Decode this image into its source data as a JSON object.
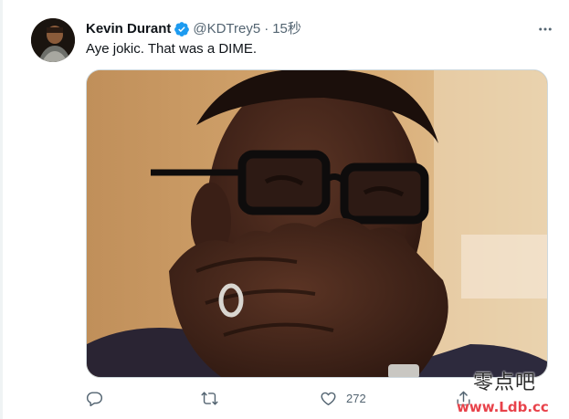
{
  "tweet": {
    "author_name": "Kevin Durant",
    "handle": "@KDTrey5",
    "separator": "·",
    "timestamp": "15秒",
    "text": "Aye jokic. That was a DIME."
  },
  "actions": {
    "replies": "",
    "retweets": "",
    "likes": "272"
  },
  "colors": {
    "verified_badge": "#1d9bf0",
    "secondary_text": "#536471",
    "primary_text": "#0f1419",
    "watermark_url": "#e8424a"
  },
  "watermark": {
    "chinese": "零点吧",
    "url": "www.Ldb.cc"
  },
  "icons": {
    "verified": "verified-badge-icon",
    "more": "more-options-icon",
    "reply": "reply-icon",
    "retweet": "retweet-icon",
    "like": "heart-icon",
    "share": "share-icon"
  }
}
